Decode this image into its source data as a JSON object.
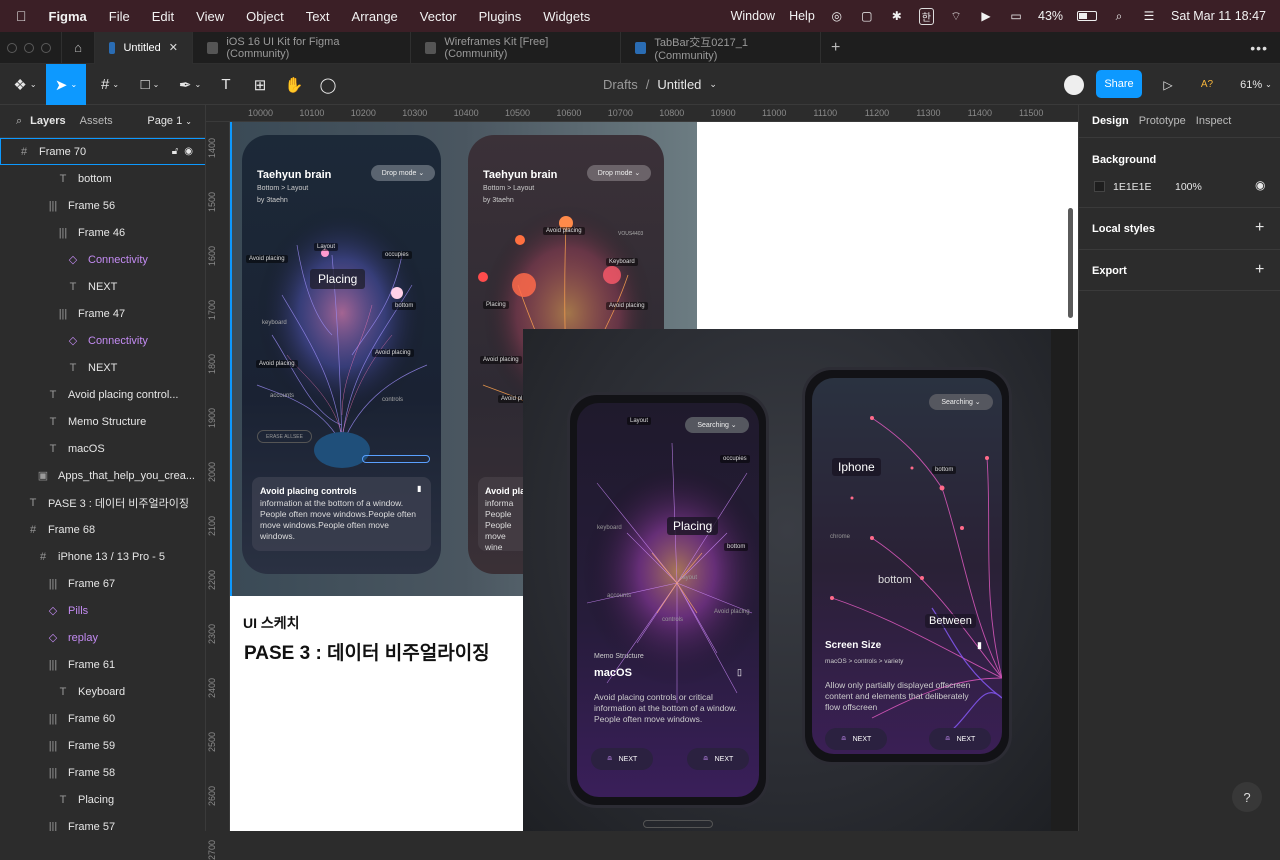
{
  "menubar": {
    "app": "Figma",
    "items": [
      "File",
      "Edit",
      "View",
      "Object",
      "Text",
      "Arrange",
      "Vector",
      "Plugins",
      "Widgets"
    ],
    "right_items": [
      "Window",
      "Help"
    ],
    "battery": "43%",
    "clock": "Sat Mar 11  18:47",
    "ime": "한"
  },
  "tabs": [
    {
      "label": "Untitled",
      "active": true
    },
    {
      "label": "iOS 16 UI Kit for Figma (Community)",
      "active": false
    },
    {
      "label": "Wireframes Kit [Free] (Community)",
      "active": false
    },
    {
      "label": "TabBar交互0217_1 (Community)",
      "active": false
    }
  ],
  "toolbar": {
    "breadcrumb_parent": "Drafts",
    "breadcrumb_sep": "/",
    "file_name": "Untitled",
    "share_label": "Share",
    "a11y": "A?",
    "zoom": "61%"
  },
  "leftpanel": {
    "tab_layers": "Layers",
    "tab_assets": "Assets",
    "page": "Page 1",
    "layers": [
      {
        "name": "Frame 70",
        "icon": "#",
        "indent": 0,
        "selected": true
      },
      {
        "name": "bottom",
        "icon": "T",
        "indent": 4
      },
      {
        "name": "Frame 56",
        "icon": "|||",
        "indent": 3
      },
      {
        "name": "Frame 46",
        "icon": "|||",
        "indent": 4
      },
      {
        "name": "Connectivity",
        "icon": "◇",
        "indent": 5,
        "purple": true
      },
      {
        "name": "NEXT",
        "icon": "T",
        "indent": 5
      },
      {
        "name": "Frame 47",
        "icon": "|||",
        "indent": 4
      },
      {
        "name": "Connectivity",
        "icon": "◇",
        "indent": 5,
        "purple": true
      },
      {
        "name": "NEXT",
        "icon": "T",
        "indent": 5
      },
      {
        "name": "Avoid placing control...",
        "icon": "T",
        "indent": 3
      },
      {
        "name": "Memo Structure",
        "icon": "T",
        "indent": 3
      },
      {
        "name": "macOS",
        "icon": "T",
        "indent": 3
      },
      {
        "name": "Apps_that_help_you_crea...",
        "icon": "▣",
        "indent": 2
      },
      {
        "name": "PASE 3 : 데이터 비주얼라이징",
        "icon": "T",
        "indent": 1
      },
      {
        "name": "Frame 68",
        "icon": "#",
        "indent": 1
      },
      {
        "name": "iPhone 13 / 13 Pro - 5",
        "icon": "#",
        "indent": 2
      },
      {
        "name": "Frame 67",
        "icon": "|||",
        "indent": 3
      },
      {
        "name": "Pills",
        "icon": "◇",
        "indent": 3,
        "purple": true
      },
      {
        "name": "replay",
        "icon": "◇",
        "indent": 3,
        "purple": true
      },
      {
        "name": "Frame 61",
        "icon": "|||",
        "indent": 3
      },
      {
        "name": "Keyboard",
        "icon": "T",
        "indent": 4
      },
      {
        "name": "Frame 60",
        "icon": "|||",
        "indent": 3
      },
      {
        "name": "Frame 59",
        "icon": "|||",
        "indent": 3
      },
      {
        "name": "Frame 58",
        "icon": "|||",
        "indent": 3
      },
      {
        "name": "Placing",
        "icon": "T",
        "indent": 4
      },
      {
        "name": "Frame 57",
        "icon": "|||",
        "indent": 3
      }
    ]
  },
  "rulers": {
    "top": [
      "10000",
      "10100",
      "10200",
      "10300",
      "10400",
      "10500",
      "10600",
      "10700",
      "10800",
      "10900",
      "11000",
      "11100",
      "11200",
      "11300",
      "11400",
      "11500"
    ],
    "left": [
      "1400",
      "1500",
      "1600",
      "1700",
      "1800",
      "1900",
      "2000",
      "2100",
      "2200",
      "2300",
      "2400",
      "2500",
      "2600",
      "2700"
    ]
  },
  "rightpanel": {
    "tabs": [
      "Design",
      "Prototype",
      "Inspect"
    ],
    "background_label": "Background",
    "bg_hex": "1E1E1E",
    "bg_opacity": "100%",
    "local_styles": "Local styles",
    "export": "Export",
    "help": "?"
  },
  "canvas": {
    "card1": {
      "title": "Taehyun brain",
      "path": "Bottom > Layout",
      "by": "by 3taehn",
      "mode": "Drop mode",
      "center": "Placing",
      "tags": [
        "Layout",
        "occupies",
        "Avoid placing",
        "bottom",
        "keyboard",
        "Avoid placing",
        "Avoid placing",
        "accounts",
        "controls"
      ],
      "search_hint": "ERASE ALLSEE",
      "memo_title": "Avoid placing controls",
      "memo_body": "information at the bottom of a window. People often move windows.People often move windows.People often move windows."
    },
    "card2": {
      "title": "Taehyun brain",
      "path": "Bottom > Layout",
      "by": "by 3taehn",
      "mode": "Drop mode",
      "tags": [
        "Avoid placing",
        "VOUS4403",
        "Keyboard",
        "Placing",
        "Avoid placing",
        "Avoid placing",
        "Avoid pl"
      ],
      "memo_title": "Avoid pla",
      "memo_body": "informa People People move wine"
    },
    "sketch_label": "UI 스케치",
    "phase_title": "PASE 3 : 데이터 비주얼라이징",
    "phoneA": {
      "mode": "Searching",
      "center": "Placing",
      "tags": [
        "Layout",
        "occupies",
        "keyboard",
        "bottom",
        "accounts",
        "layout",
        "Avoid placing",
        "controls"
      ],
      "memo": "Memo Structure",
      "title": "macOS",
      "body": "Avoid placing controls or critical information at the bottom of a window. People often move windows.",
      "next1": "NEXT",
      "next2": "NEXT"
    },
    "phoneB": {
      "mode": "Searching",
      "label1": "Iphone",
      "label2": "bottom",
      "label3": "Between",
      "tags": [
        "bottom",
        "chrome"
      ],
      "title": "Screen Size",
      "path": "macOS > controls  > variety",
      "body": "Allow only partially displayed offscreen content and elements that deliberately flow offscreen",
      "next1": "NEXT",
      "next2": "NEXT"
    }
  }
}
